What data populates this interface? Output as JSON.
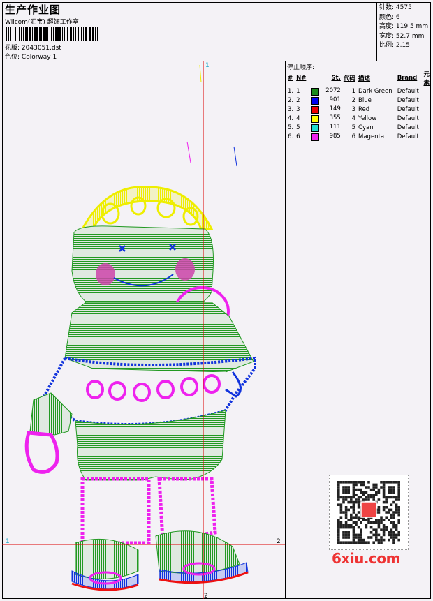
{
  "header": {
    "title": "生产作业图",
    "company": "Wilcom(汇宝) 超饰工作室",
    "design_label": "花版:",
    "design_file": "2043051.dst",
    "colorway_label": "色位:",
    "colorway": "Colorway 1"
  },
  "stats": [
    {
      "label": "针数:",
      "value": "4575"
    },
    {
      "label": "颜色:",
      "value": "6"
    },
    {
      "label": "高度:",
      "value": "119.5 mm"
    },
    {
      "label": "宽度:",
      "value": "52.7 mm"
    },
    {
      "label": "比例:",
      "value": "2.15"
    }
  ],
  "stop_sequence": {
    "heading": "停止顺序:",
    "columns": [
      "#",
      "N#",
      "St.",
      "代码",
      "描述",
      "Brand",
      "元素"
    ],
    "rows": [
      {
        "idx": "1.",
        "n": "1",
        "color": "#1a8a1a",
        "st": "2072",
        "code": "1",
        "desc": "Dark Green",
        "brand": "Default"
      },
      {
        "idx": "2.",
        "n": "2",
        "color": "#0000ee",
        "st": "901",
        "code": "2",
        "desc": "Blue",
        "brand": "Default"
      },
      {
        "idx": "3.",
        "n": "3",
        "color": "#ee0000",
        "st": "149",
        "code": "3",
        "desc": "Red",
        "brand": "Default"
      },
      {
        "idx": "4.",
        "n": "4",
        "color": "#ffff00",
        "st": "355",
        "code": "4",
        "desc": "Yellow",
        "brand": "Default"
      },
      {
        "idx": "5.",
        "n": "5",
        "color": "#22ddcc",
        "st": "111",
        "code": "5",
        "desc": "Cyan",
        "brand": "Default"
      },
      {
        "idx": "6.",
        "n": "6",
        "color": "#ee22ee",
        "st": "985",
        "code": "6",
        "desc": "Magenta",
        "brand": "Default"
      }
    ]
  },
  "canvas_markers": {
    "top": "1",
    "bottom": "2",
    "left": "1",
    "right": "2"
  },
  "watermark": "6xiu.com",
  "colors": {
    "green": "#229922",
    "blue": "#1133dd",
    "red": "#ee1111",
    "yellow": "#eeee00",
    "magenta": "#ee22ee",
    "guide": "#dd0000"
  }
}
